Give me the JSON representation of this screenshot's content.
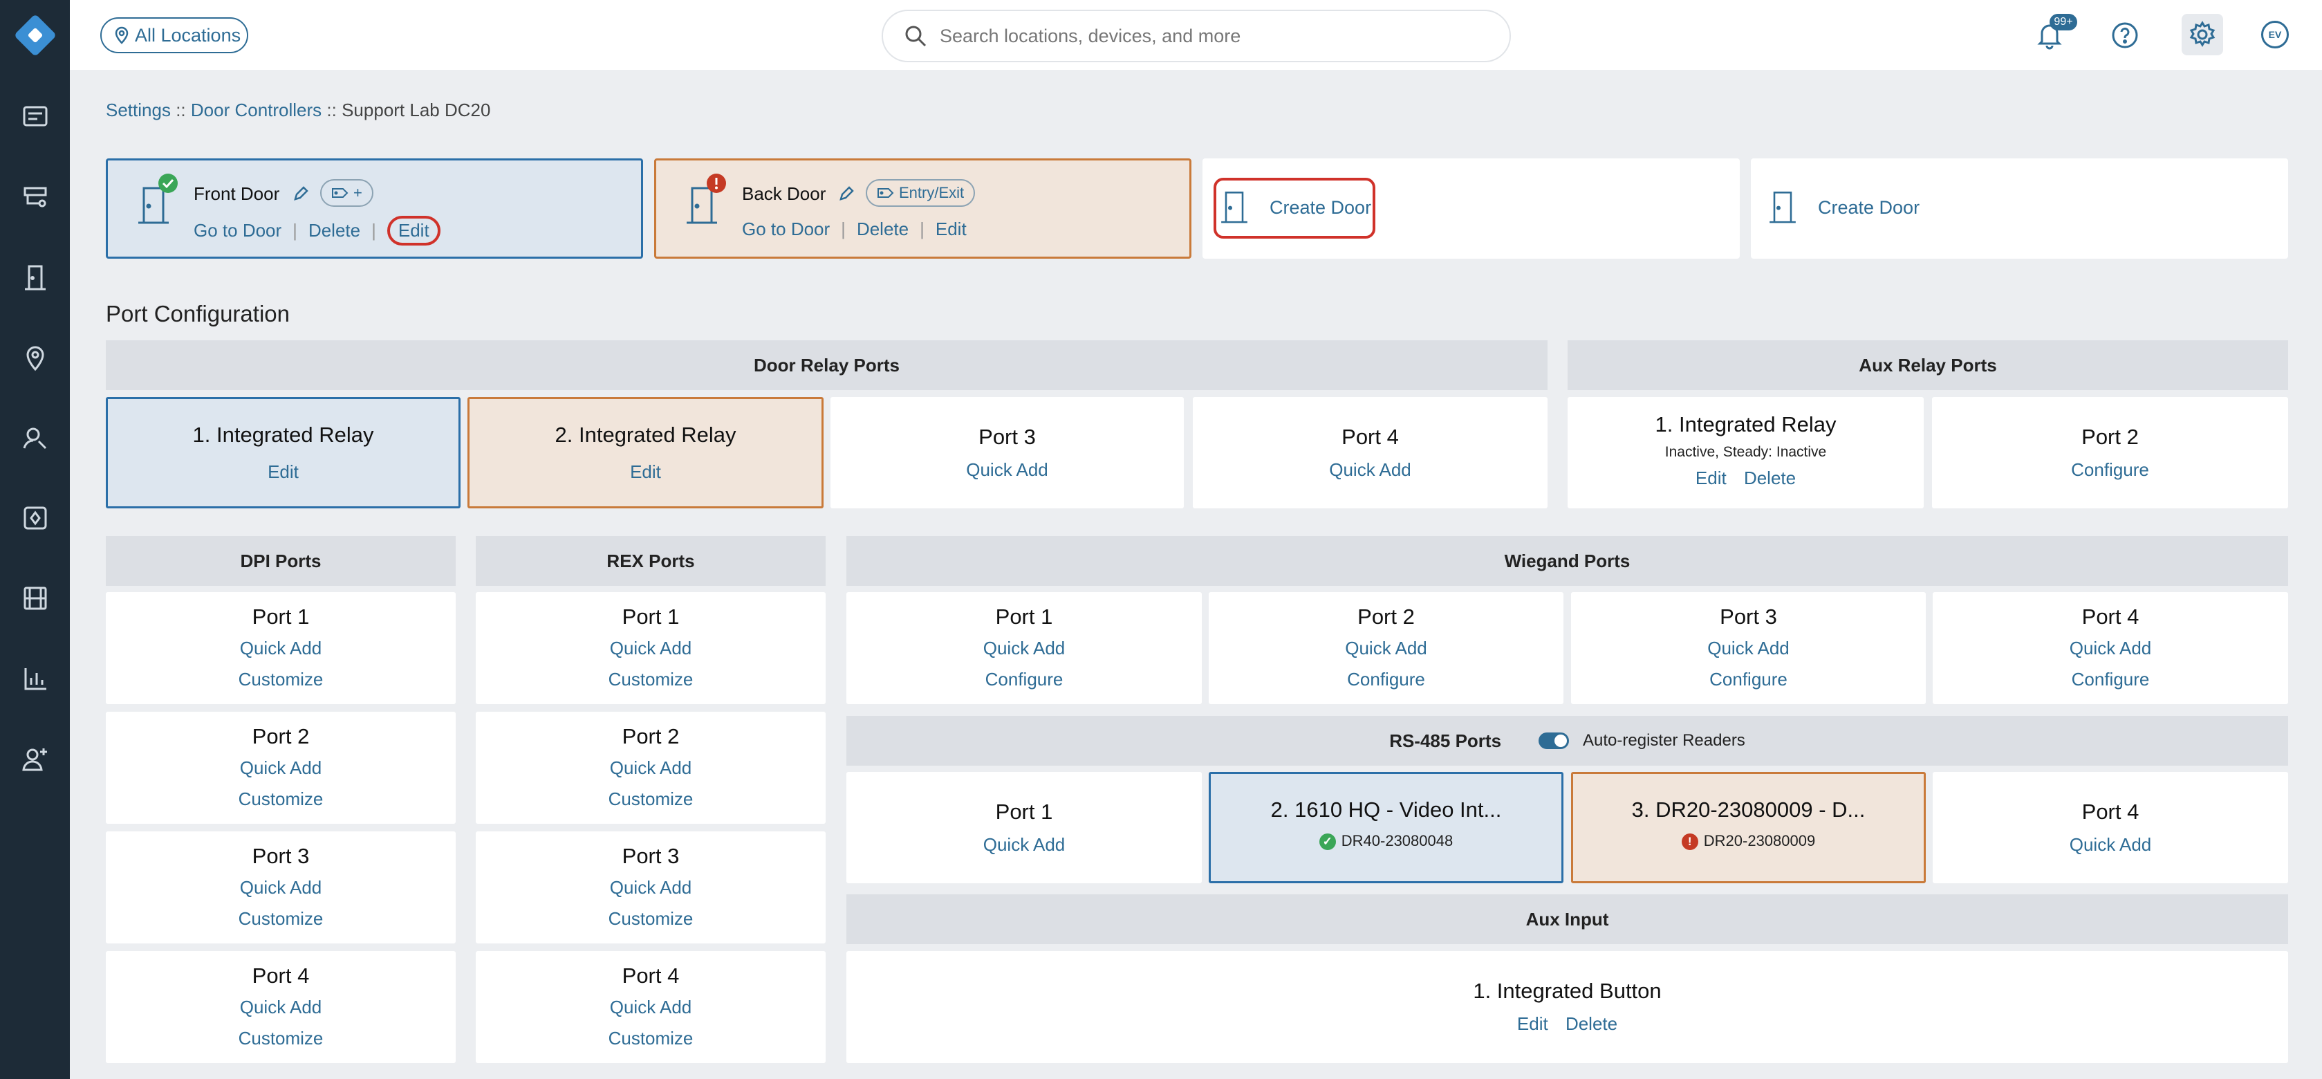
{
  "sidebar": {
    "items": [
      "dashboard-icon",
      "devices-icon",
      "door-icon",
      "location-icon",
      "search-person-icon",
      "plugin-icon",
      "video-icon",
      "reports-icon",
      "add-user-icon"
    ]
  },
  "topbar": {
    "location_filter": "All Locations",
    "search_placeholder": "Search locations, devices, and more",
    "notification_count": "99+",
    "avatar_initials": "EV"
  },
  "breadcrumb": {
    "items": [
      "Settings",
      "Door Controllers",
      "Support Lab DC20"
    ],
    "separator": "::"
  },
  "doors": [
    {
      "name": "Front Door",
      "status": "ok",
      "tag": "+",
      "links": [
        "Go to Door",
        "Delete",
        "Edit"
      ]
    },
    {
      "name": "Back Door",
      "status": "error",
      "tag": "Entry/Exit",
      "links": [
        "Go to Door",
        "Delete",
        "Edit"
      ]
    }
  ],
  "create_door": {
    "label": "Create Door"
  },
  "port_config": {
    "title": "Port Configuration",
    "door_relay": {
      "header": "Door Relay Ports",
      "ports": [
        {
          "title": "1.  Integrated Relay",
          "link": "Edit"
        },
        {
          "title": "2.  Integrated Relay",
          "link": "Edit"
        },
        {
          "title": "Port 3",
          "link": "Quick Add"
        },
        {
          "title": "Port 4",
          "link": "Quick Add"
        }
      ]
    },
    "aux_relay": {
      "header": "Aux Relay Ports",
      "ports": [
        {
          "title": "1.  Integrated Relay",
          "status": "Inactive, Steady: Inactive",
          "links": [
            "Edit",
            "Delete"
          ]
        },
        {
          "title": "Port 2",
          "link": "Configure"
        }
      ]
    },
    "dpi": {
      "header": "DPI Ports",
      "ports": [
        {
          "title": "Port 1",
          "links": [
            "Quick Add",
            "Customize"
          ]
        },
        {
          "title": "Port 2",
          "links": [
            "Quick Add",
            "Customize"
          ]
        },
        {
          "title": "Port 3",
          "links": [
            "Quick Add",
            "Customize"
          ]
        },
        {
          "title": "Port 4",
          "links": [
            "Quick Add",
            "Customize"
          ]
        }
      ]
    },
    "rex": {
      "header": "REX Ports",
      "ports": [
        {
          "title": "Port 1",
          "links": [
            "Quick Add",
            "Customize"
          ]
        },
        {
          "title": "Port 2",
          "links": [
            "Quick Add",
            "Customize"
          ]
        },
        {
          "title": "Port 3",
          "links": [
            "Quick Add",
            "Customize"
          ]
        },
        {
          "title": "Port 4",
          "links": [
            "Quick Add",
            "Customize"
          ]
        }
      ]
    },
    "wiegand": {
      "header": "Wiegand Ports",
      "ports": [
        {
          "title": "Port 1",
          "links": [
            "Quick Add",
            "Configure"
          ]
        },
        {
          "title": "Port 2",
          "links": [
            "Quick Add",
            "Configure"
          ]
        },
        {
          "title": "Port 3",
          "links": [
            "Quick Add",
            "Configure"
          ]
        },
        {
          "title": "Port 4",
          "links": [
            "Quick Add",
            "Configure"
          ]
        }
      ]
    },
    "rs485": {
      "header": "RS-485 Ports",
      "toggle_label": "Auto-register Readers",
      "toggle_on": true,
      "ports": [
        {
          "title": "Port 1",
          "link": "Quick Add"
        },
        {
          "title": "2.  1610 HQ - Video Int...",
          "device": "DR40-23080048",
          "status": "ok"
        },
        {
          "title": "3.  DR20-23080009 - D...",
          "device": "DR20-23080009",
          "status": "error"
        },
        {
          "title": "Port 4",
          "link": "Quick Add"
        }
      ]
    },
    "aux_input": {
      "header": "Aux Input",
      "title": "1.  Integrated Button",
      "links": [
        "Edit",
        "Delete"
      ]
    }
  },
  "colors": {
    "accent": "#2e6c95",
    "sidebar": "#1d2b37",
    "ok": "#3aa657",
    "error": "#c53a24",
    "highlight": "#d0322a"
  }
}
